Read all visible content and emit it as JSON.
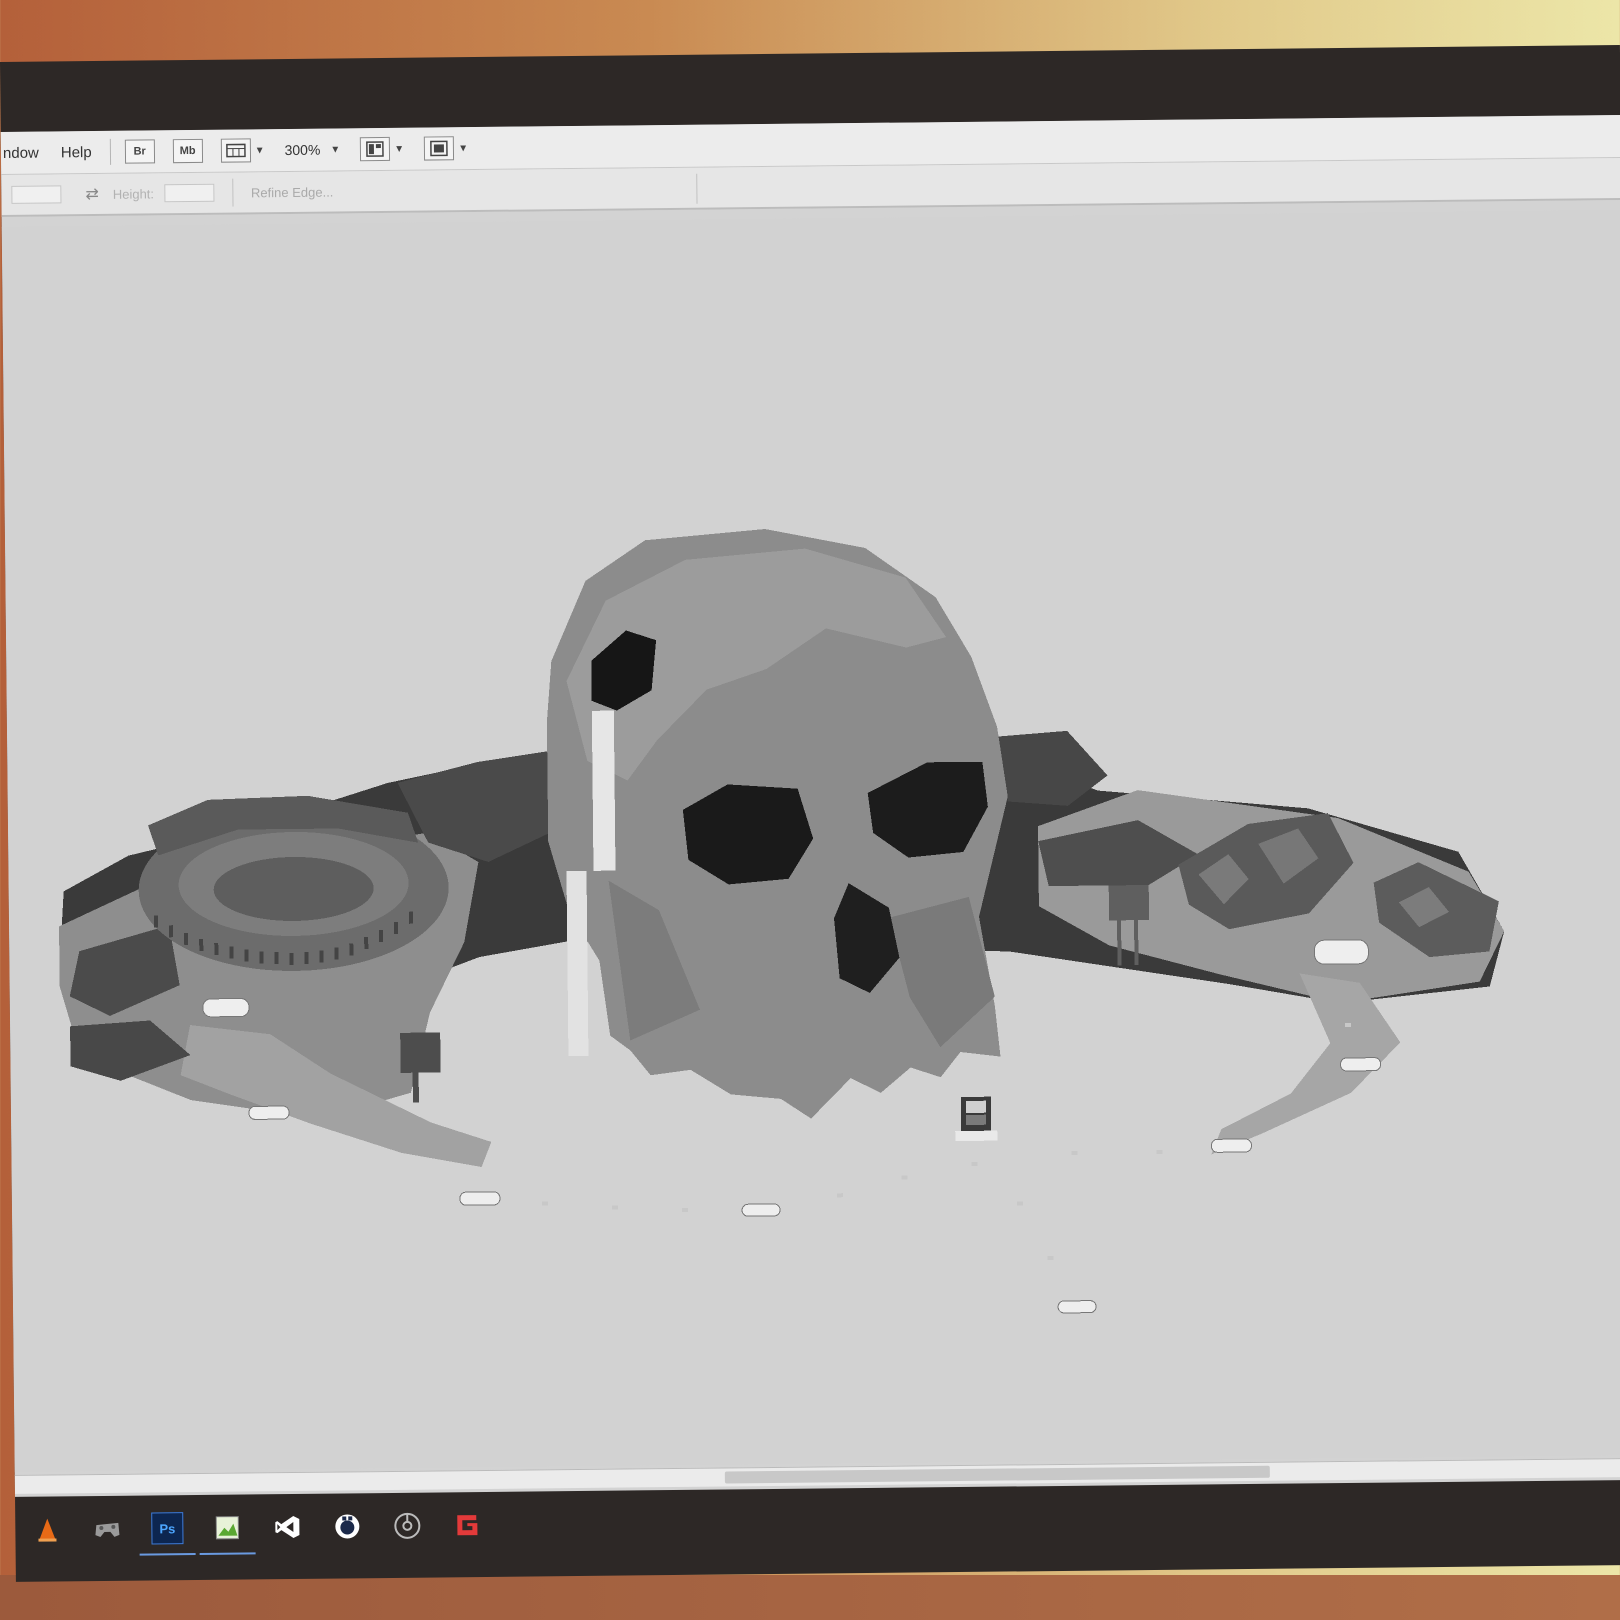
{
  "menubar": {
    "items": [
      "ndow",
      "Help"
    ],
    "bridge_button": "Br",
    "minibridge_button": "Mb",
    "zoom": "300%"
  },
  "optionsbar": {
    "height_label": "Height:",
    "refine_edge": "Refine Edge..."
  },
  "scene": {
    "title": "pixel art map with giant skull, colosseum and village",
    "style": "grayscale pixel art"
  },
  "taskbar": {
    "apps": [
      {
        "name": "vlc-icon",
        "color": "#e86a16"
      },
      {
        "name": "game-controller-icon",
        "color": "#9a9a9a"
      },
      {
        "name": "photoshop-icon",
        "label": "Ps",
        "color": "#1c4f9c",
        "active": true
      },
      {
        "name": "image-editor-icon",
        "color": "#5aa832",
        "active": true
      },
      {
        "name": "visual-studio-icon",
        "color": "#ffffff"
      },
      {
        "name": "gamemaker-icon",
        "color": "#ffffff"
      },
      {
        "name": "chrome-icon",
        "color": "#bbbbbb"
      },
      {
        "name": "gamemaker-studio-icon",
        "color": "#e33a3a"
      }
    ]
  }
}
